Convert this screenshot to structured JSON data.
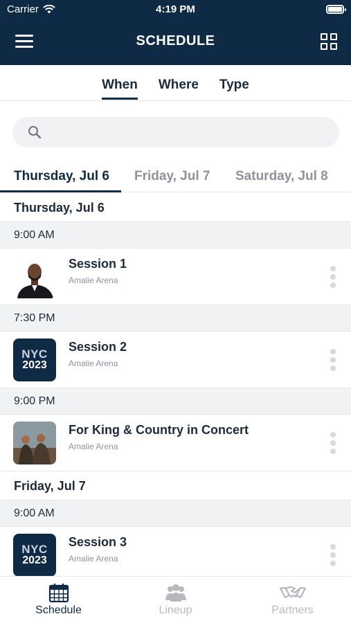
{
  "status": {
    "carrier": "Carrier",
    "time": "4:19 PM"
  },
  "header": {
    "title": "SCHEDULE"
  },
  "segments": [
    {
      "label": "When",
      "active": true
    },
    {
      "label": "Where",
      "active": false
    },
    {
      "label": "Type",
      "active": false
    }
  ],
  "search": {
    "placeholder": "",
    "value": ""
  },
  "day_tabs": [
    {
      "label": "Thursday, Jul 6",
      "active": true
    },
    {
      "label": "Friday, Jul 7",
      "active": false
    },
    {
      "label": "Saturday, Jul 8",
      "active": false
    }
  ],
  "schedule": {
    "day1": {
      "label": "Thursday, Jul 6",
      "slot1": {
        "time": "9:00 AM",
        "title": "Session 1",
        "venue": "Amalie Arena"
      },
      "slot2": {
        "time": "7:30 PM",
        "title": "Session 2",
        "venue": "Amalie Arena",
        "badge_top": "NYC",
        "badge_bottom": "2023"
      },
      "slot3": {
        "time": "9:00 PM",
        "title": "For King & Country in Concert",
        "venue": "Amalie Arena"
      }
    },
    "day2": {
      "label": "Friday, Jul 7",
      "slot1": {
        "time": "9:00 AM",
        "title": "Session 3",
        "venue": "Amalie Arena",
        "badge_top": "NYC",
        "badge_bottom": "2023"
      }
    }
  },
  "tabbar": [
    {
      "label": "Schedule",
      "icon": "calendar-icon",
      "active": true
    },
    {
      "label": "Lineup",
      "icon": "people-icon",
      "active": false
    },
    {
      "label": "Partners",
      "icon": "handshake-icon",
      "active": false
    }
  ],
  "colors": {
    "primary": "#0f2a44",
    "inactive": "#8d939b",
    "divider": "#e3e6ea",
    "section_bg": "#f1f2f4"
  }
}
